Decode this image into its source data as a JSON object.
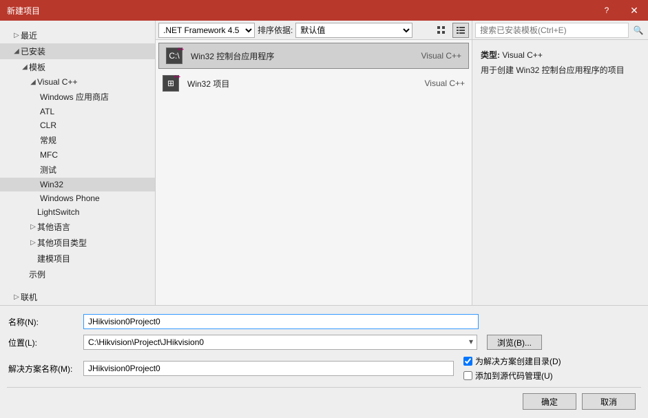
{
  "title": "新建项目",
  "tree": {
    "recent": "最近",
    "installed": "已安装",
    "templates": "模板",
    "vcpp": "Visual C++",
    "vcpp_children": [
      "Windows 应用商店",
      "ATL",
      "CLR",
      "常规",
      "MFC",
      "测试",
      "Win32",
      "Windows Phone"
    ],
    "lightswitch": "LightSwitch",
    "other_lang": "其他语言",
    "other_proj": "其他项目类型",
    "modeling": "建模项目",
    "samples": "示例",
    "online": "联机"
  },
  "toolbar": {
    "framework": ".NET Framework 4.5",
    "sort_label": "排序依据:",
    "sort_value": "默认值"
  },
  "templates": [
    {
      "name": "Win32 控制台应用程序",
      "lang": "Visual C++",
      "icon": "C:\\"
    },
    {
      "name": "Win32 项目",
      "lang": "Visual C++",
      "icon": "⊞"
    }
  ],
  "search": {
    "placeholder": "搜索已安装模板(Ctrl+E)"
  },
  "desc": {
    "type_label": "类型:",
    "type_value": "Visual C++",
    "text": "用于创建 Win32 控制台应用程序的项目"
  },
  "form": {
    "name_label": "名称(N):",
    "name_value": "JHikvision0Project0",
    "loc_label": "位置(L):",
    "loc_value": "C:\\Hikvision\\Project\\JHikvision0",
    "sol_label": "解决方案名称(M):",
    "sol_value": "JHikvision0Project0",
    "browse": "浏览(B)...",
    "chk_createdir": "为解决方案创建目录(D)",
    "chk_source": "添加到源代码管理(U)"
  },
  "buttons": {
    "ok": "确定",
    "cancel": "取消"
  }
}
